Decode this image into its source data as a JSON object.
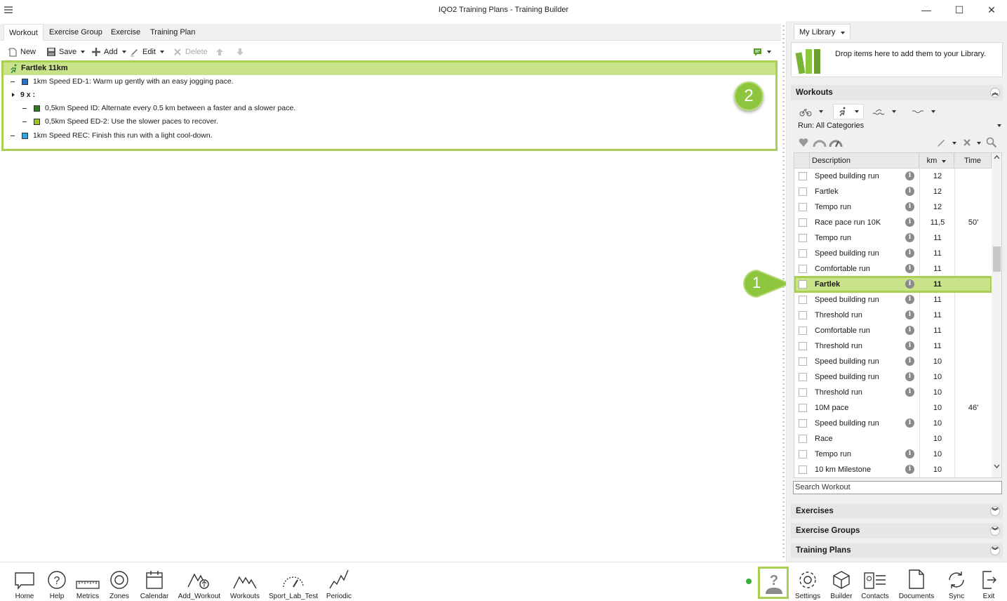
{
  "window": {
    "title": "IQO2 Training Plans - Training Builder",
    "minimize": "—",
    "maximize": "☐",
    "close": "✕"
  },
  "tabs": [
    "Workout",
    "Exercise Group",
    "Exercise",
    "Training Plan"
  ],
  "toolbar": {
    "new": "New",
    "save": "Save",
    "add": "Add",
    "edit": "Edit",
    "delete": "Delete"
  },
  "workout": {
    "title": "Fartlek 11km",
    "steps": [
      {
        "text": "1km Speed ED-1: Warm up gently with an easy jogging pace.",
        "color": "#2f6fc4"
      },
      {
        "text": "9 x :",
        "repeat": true
      },
      {
        "text": "0,5km Speed ID: Alternate every 0.5 km between a faster and a slower pace.",
        "color": "#2e7d1f"
      },
      {
        "text": "0,5km Speed ED-2: Use the slower paces to recover.",
        "color": "#9bc41d"
      },
      {
        "text": "1km Speed REC: Finish this run with a light cool-down.",
        "color": "#39a5d8"
      }
    ]
  },
  "markers": {
    "one": "1",
    "two": "2"
  },
  "library": {
    "tab": "My Library",
    "drop_text": "Drop items here to add them to your Library.",
    "workouts_header": "Workouts",
    "category": "Run: All Categories",
    "columns": {
      "description": "Description",
      "km": "km",
      "time": "Time"
    },
    "rows": [
      {
        "desc": "Speed building run",
        "km": "12",
        "time": "",
        "info": true
      },
      {
        "desc": "Fartlek",
        "km": "12",
        "time": "",
        "info": true
      },
      {
        "desc": "Tempo run",
        "km": "12",
        "time": "",
        "info": true
      },
      {
        "desc": "Race pace run 10K",
        "km": "11,5",
        "time": "50'",
        "info": true
      },
      {
        "desc": "Tempo run",
        "km": "11",
        "time": "",
        "info": true
      },
      {
        "desc": "Speed building run",
        "km": "11",
        "time": "",
        "info": true
      },
      {
        "desc": "Comfortable run",
        "km": "11",
        "time": "",
        "info": true
      },
      {
        "desc": "Fartlek",
        "km": "11",
        "time": "",
        "info": true,
        "selected": true
      },
      {
        "desc": "Speed building run",
        "km": "11",
        "time": "",
        "info": true
      },
      {
        "desc": "Threshold run",
        "km": "11",
        "time": "",
        "info": true
      },
      {
        "desc": "Comfortable run",
        "km": "11",
        "time": "",
        "info": true
      },
      {
        "desc": "Threshold run",
        "km": "11",
        "time": "",
        "info": true
      },
      {
        "desc": "Speed building run",
        "km": "10",
        "time": "",
        "info": true
      },
      {
        "desc": "Speed building run",
        "km": "10",
        "time": "",
        "info": true
      },
      {
        "desc": "Threshold run",
        "km": "10",
        "time": "",
        "info": true
      },
      {
        "desc": "10M pace",
        "km": "10",
        "time": "46'",
        "info": false
      },
      {
        "desc": "Speed building run",
        "km": "10",
        "time": "",
        "info": true
      },
      {
        "desc": "Race",
        "km": "10",
        "time": "",
        "info": false
      },
      {
        "desc": "Tempo run",
        "km": "10",
        "time": "",
        "info": true
      },
      {
        "desc": "10 km Milestone",
        "km": "10",
        "time": "",
        "info": true
      }
    ],
    "search_placeholder": "Search Workout",
    "sections": [
      "Exercises",
      "Exercise Groups",
      "Training Plans"
    ]
  },
  "bottom_nav": {
    "left": [
      "Home",
      "Help",
      "Metrics",
      "Zones",
      "Calendar",
      "Add_Workout",
      "Workouts",
      "Sport_Lab_Test",
      "Periodic"
    ],
    "right": [
      "Settings",
      "Builder",
      "Contacts",
      "Documents",
      "Sync",
      "Exit"
    ]
  }
}
